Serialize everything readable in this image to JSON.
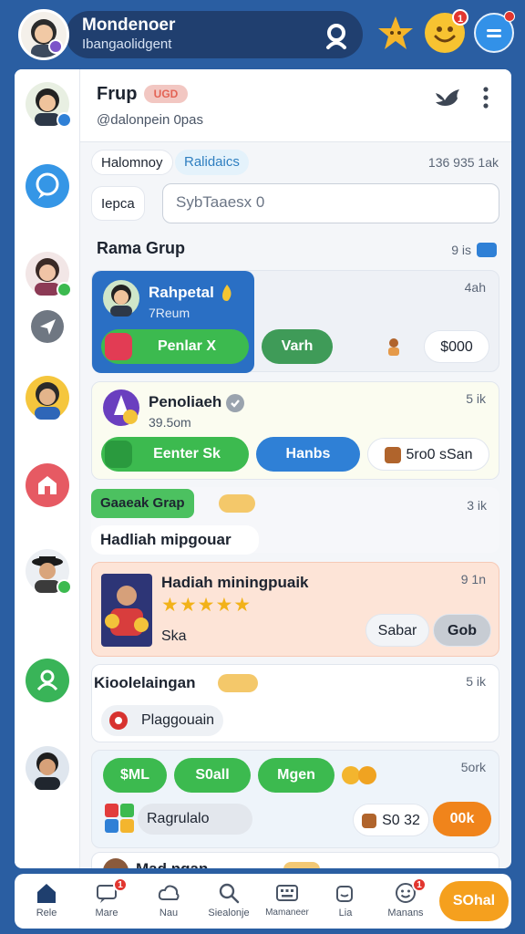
{
  "header": {
    "title": "Mondenoer",
    "subtitle": "Ibangaolidgent"
  },
  "chat": {
    "title": "Frup",
    "tag": "UGD",
    "handle": "@dalonpein 0pas",
    "filter_chip_1": "Halomnoy",
    "filter_chip_2": "Ralidaics",
    "count_text": "136 935 1ak",
    "search_chip": "Iepca",
    "search_value": "SybTaaesx 0",
    "section_title": "Rama Grup",
    "section_meta": "9 is"
  },
  "messages": {
    "m1": {
      "name": "Rahpetal",
      "sub": "7Reum",
      "time": "4ah",
      "primary_label": "Penlar X",
      "secondary_label": "Varh",
      "amount": "$000"
    },
    "m2": {
      "name": "Penoliaeh",
      "sub": "39.5om",
      "time": "5 ik",
      "primary_label": "Eenter Sk",
      "secondary_label": "Hanbs",
      "amount": "5ro0 sSan"
    },
    "group": {
      "tag": "Gaaeak Grap",
      "time": "3 ik",
      "line": "Hadliah mipgouar"
    },
    "m3": {
      "name": "Hadiah miningpuaik",
      "rating": "★★★★★",
      "sub": "Ska",
      "time": "9 1n",
      "ghost_label": "Sabar",
      "action_label": "Gob"
    },
    "m4": {
      "name": "Kioolelaingan",
      "time": "5 ik",
      "line": "Plaggouain"
    },
    "m5": {
      "time": "5ork",
      "chip_1": "$ML",
      "chip_2": "S0all",
      "chip_3": "Mgen",
      "line": "Ragrulalo",
      "amount": "S0 32",
      "cta": "00k"
    },
    "m6": {
      "name": "Mad ngan"
    }
  },
  "bottom_nav": {
    "items": [
      {
        "label": "Rele"
      },
      {
        "label": "Mare"
      },
      {
        "label": "Nau"
      },
      {
        "label": "Siealonje"
      },
      {
        "label": "Mamaneer"
      },
      {
        "label": "Lia"
      },
      {
        "label": "Manans"
      }
    ],
    "cta": "SOhal"
  },
  "colors": {
    "background": "#2a5ea2",
    "primary_green": "#3cba4f",
    "primary_blue": "#2f80d6",
    "accent_orange": "#f0841b",
    "accent_red": "#e2362f"
  }
}
